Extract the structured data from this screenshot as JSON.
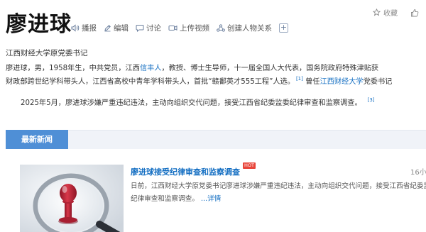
{
  "header": {
    "title": "廖进球",
    "actions": [
      {
        "label": "收藏",
        "icon": "star-icon"
      },
      {
        "label": "",
        "icon": "thumbs-up-icon"
      }
    ]
  },
  "toolbar": {
    "items": [
      {
        "label": "播报",
        "icon": "speaker-icon"
      },
      {
        "label": "编辑",
        "icon": "pencil-icon"
      },
      {
        "label": "讨论",
        "icon": "chat-bubble-icon"
      },
      {
        "label": "上传视频",
        "icon": "video-camera-icon"
      },
      {
        "label": "创建人物关系",
        "icon": "people-network-icon"
      },
      {
        "label": "+",
        "icon": "plus-icon"
      }
    ]
  },
  "subtitle": "江西财经大学原党委书记",
  "summary": {
    "line1_a": "廖进球，男，1958年生，中共党员，江西",
    "line1_link": "信丰人",
    "line1_b": "，教授、博士生导师，十一届全国人大代表，国务院政府特殊津贴获",
    "line2_a": "财政部跨世纪学科带头人，江西省高校中青年学科带头人，首批“赣鄱英才555工程”人选。",
    "line2_ref": "[1]",
    "line2_b": "曾任",
    "line2_link": "江西财经大学",
    "line2_c": "党委书记",
    "line3": "2025年5月，廖进球涉嫌严重违纪违法，主动向组织交代问题，接受江西省纪委监委纪律审查和监察调查。",
    "line3_ref": "[3]"
  },
  "news": {
    "section_title": "最新新闻",
    "items": [
      {
        "title": "廖进球接受纪律审查和监察调查",
        "badge": "HOT",
        "date": "16小",
        "summary_line1": "日前，江西财经大学原党委书记廖进球涉嫌严重违纪违法，主动向组织交代问题，接受江西省纪委监",
        "summary_line2": "纪律审查和监察调查。",
        "more": "...详情"
      }
    ]
  },
  "colors": {
    "link": "#136ec2",
    "tab_bg": "#4f8fd6",
    "hot_badge": "#e8463b",
    "pin_red": "#c0273a"
  }
}
